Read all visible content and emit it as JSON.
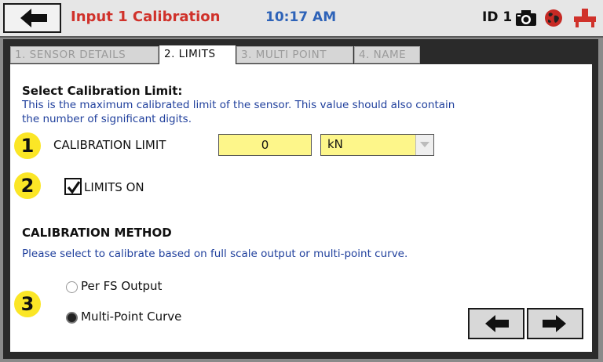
{
  "header": {
    "title": "Input 1 Calibration",
    "time": "10:17 AM",
    "id_text": "ID 1"
  },
  "tabs": [
    {
      "label": "1. SENSOR DETAILS",
      "active": false
    },
    {
      "label": "2. LIMITS",
      "active": true
    },
    {
      "label": "3. MULTI POINT",
      "active": false
    },
    {
      "label": "4. NAME",
      "active": false
    }
  ],
  "limit_section": {
    "heading": "Select Calibration Limit:",
    "description_line1": "This is the maximum calibrated limit of the sensor.  This value should also contain",
    "description_line2": "the number of significant digits.",
    "step1": "1",
    "step2": "2",
    "cal_limit_label": "CALIBRATION LIMIT",
    "cal_limit_value": "0",
    "unit_value": "kN",
    "limits_on_label": "LIMITS ON",
    "limits_on_checked": true
  },
  "method_section": {
    "heading": "CALIBRATION METHOD",
    "description": "Please select to calibrate based on full scale output or multi-point curve.",
    "step3": "3",
    "options": [
      {
        "label": "Per FS Output",
        "selected": false
      },
      {
        "label": "Multi-Point Curve",
        "selected": true
      }
    ]
  },
  "colors": {
    "title": "#d0322b",
    "time": "#2e63b8",
    "description": "#1f3f9c",
    "step_badge": "#fbe626",
    "input_bg": "#fdf68a"
  }
}
